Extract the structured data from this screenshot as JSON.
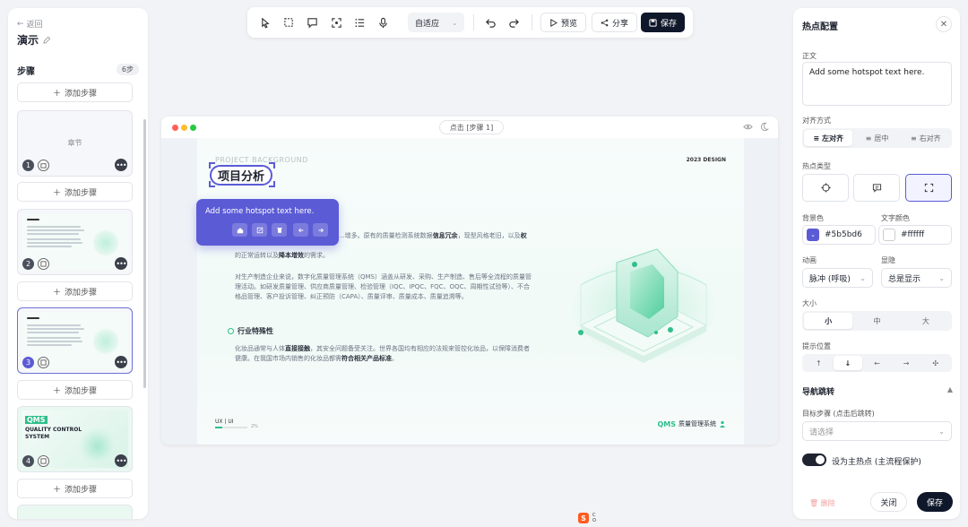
{
  "left": {
    "back": "返回",
    "title": "演示",
    "steps_header": "步骤",
    "steps_count": "6步",
    "add_step": "添加步骤",
    "cards": [
      {
        "num": "1",
        "chapter_label": "章节"
      },
      {
        "num": "2"
      },
      {
        "num": "3"
      },
      {
        "num": "4",
        "lines": [
          "QMS",
          "QUALITY CONTROL",
          "SYSTEM"
        ]
      }
    ]
  },
  "toolbar": {
    "fit": "自适应",
    "preview": "预览",
    "share": "分享",
    "save": "保存"
  },
  "canvas": {
    "step_label": "点击 [步骤 1]",
    "slide": {
      "eyebrow": "PROJECT BACKGROUND",
      "design": "2023 DESIGN",
      "hotspot_title": "项目分析",
      "p1a": "...增多。原有的质量检测系统数据",
      "p1b": "信息冗余",
      "p1c": "，现型风格老旧，以及",
      "p1d": "权",
      "p1e": "的正常运转以及",
      "p1f": "降本增效",
      "p1g": "的需求。",
      "p2": "对生产制造企业来说，数字化质量管理系统（QMS）涵盖从研发、采购、生产制造、售后等全流程的质量管理活动。如研发质量管理、供应商质量管理、检验管理（IQC、IPQC、FQC、OQC、周期性试验等）、不合格品管理、客户投诉管理、纠正预防（CAPA）、质量评审、质量成本、质量追溯等。",
      "section2": "行业特殊性",
      "p3a": "化妆品通常与人体",
      "p3b": "直接接触",
      "p3c": "，其安全问题备受关注。世界各国均有相应的法规来管控化妆品，以保障消费者健康。在我国市场内销售的化妆品都需",
      "p3d": "符合相关产品标准",
      "p3e": "。",
      "ux": "UX | UI",
      "ux_pct": "2%",
      "brand_qms": "QMS",
      "brand_text": "质量管理系统"
    },
    "popover_text": "Add some hotspot text here."
  },
  "panel": {
    "title": "热点配置",
    "body_label": "正文",
    "body_value": "Add some hotspot text here.",
    "align_label": "对齐方式",
    "align_options": [
      "左对齐",
      "居中",
      "右对齐"
    ],
    "type_label": "热点类型",
    "bg_label": "背景色",
    "bg_value": "#5b5bd6",
    "text_color_label": "文字颜色",
    "text_color_value": "#ffffff",
    "anim_label": "动画",
    "anim_value": "脉冲 (呼吸)",
    "show_label": "显隐",
    "show_value": "总是显示",
    "size_label": "大小",
    "size_options": [
      "小",
      "中",
      "大"
    ],
    "pos_label": "提示位置",
    "nav_header": "导航跳转",
    "target_label": "目标步骤 (点击后跳转)",
    "target_placeholder": "请选择",
    "main_hotspot_label": "设为主热点 (主流程保护)",
    "delete": "删除",
    "close": "关闭",
    "save": "保存"
  },
  "bottom": {
    "line1": "C",
    "line2": "O"
  },
  "colors": {
    "accent": "#5b5bd6",
    "dark": "#0f172a",
    "green": "#2fbf8a"
  }
}
